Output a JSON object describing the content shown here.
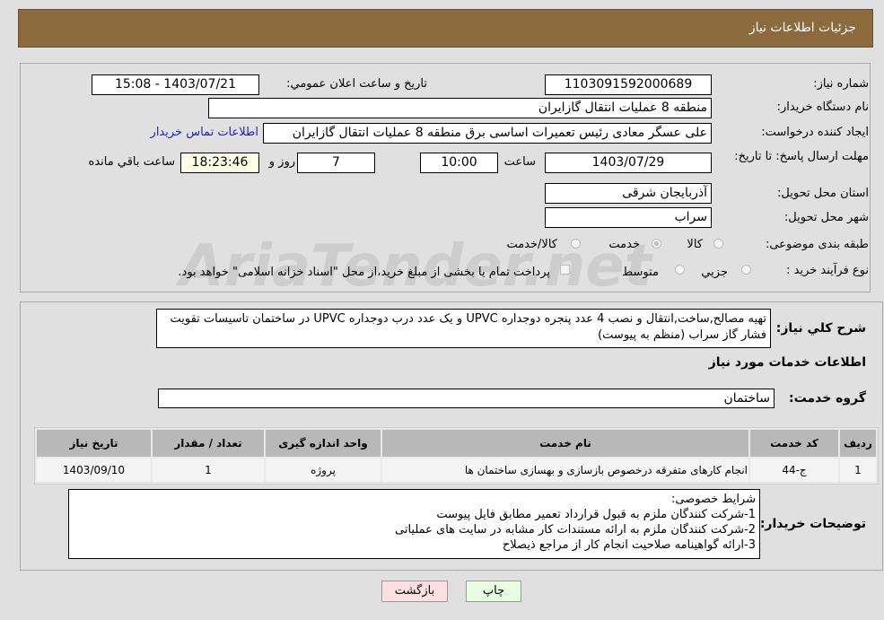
{
  "header": {
    "title": "جزئیات اطلاعات نیاز"
  },
  "form": {
    "need_number_label": "شماره نیاز:",
    "need_number": "1103091592000689",
    "announce_label": "تاریخ و ساعت اعلان عمومي:",
    "announce_value": "1403/07/21 - 15:08",
    "buyer_org_label": "نام دستگاه خریدار:",
    "buyer_org": "منطقه 8 عملیات انتقال گازایران",
    "creator_label": "ایجاد کننده درخواست:",
    "creator": "علی عسگر معادی رئیس تعمیرات اساسی برق منطقه 8 عملیات انتقال گازایران",
    "contact_link": "اطلاعات تماس خریدار",
    "deadline_label": "مهلت ارسال پاسخ: تا تاریخ:",
    "deadline_date": "1403/07/29",
    "time_label": "ساعت",
    "deadline_time": "10:00",
    "days": "7",
    "days_label": "روز و",
    "remaining": "18:23:46",
    "remaining_label": "ساعت باقي مانده",
    "province_label": "استان محل تحویل:",
    "province": "آذربایجان شرقی",
    "city_label": "شهر محل تحویل:",
    "city": "سراب",
    "category_label": "طبقه بندی موضوعی:",
    "category_options": [
      "کالا",
      "خدمت",
      "کالا/خدمت"
    ],
    "category_selected": "خدمت",
    "process_label": "نوع فرآیند خرید :",
    "process_options": [
      "جزيي",
      "متوسط"
    ],
    "payment_note": "پرداخت تمام یا بخشی از مبلغ خرید،از محل \"اسناد خزانه اسلامی\" خواهد بود."
  },
  "description": {
    "label": "شرح كلي نياز:",
    "text": "تهیه مصالح,ساخت,انتقال و نصب 4 عدد پنجره دوجداره UPVC و یک عدد درب دوجداره UPVC در ساختمان تاسیسات تقویت فشار گاز سراب (منظم به پیوست)"
  },
  "services": {
    "title": "اطلاعات خدمات مورد نیاز",
    "group_label": "گروه خدمت:",
    "group": "ساختمان",
    "columns": [
      "ردیف",
      "کد خدمت",
      "نام خدمت",
      "واحد اندازه گیری",
      "تعداد / مقدار",
      "تاریخ نیاز"
    ],
    "rows": [
      [
        "1",
        "ج-44",
        "انجام کارهای متفرقه درخصوص بازسازی و بهسازی ساختمان ها",
        "پروژه",
        "1",
        "1403/09/10"
      ]
    ]
  },
  "buyer_notes": {
    "label": "توضیحات خریدار:",
    "lines": [
      "شرایط خصوصی:",
      "1-شرکت کنندگان ملزم به قبول قرارداد تعمیر مطابق فایل پیوست",
      "2-شرکت کنندگان ملزم به ارائه مستندات کار مشابه در سایت های عملیاتی",
      "3-ارائه گواهینامه صلاحیت انجام کار از مراجع ذیصلاح"
    ]
  },
  "buttons": {
    "print": "چاپ",
    "back": "بازگشت"
  },
  "watermark": "AriaTender.net",
  "colors": {
    "header": "#8b6a3e",
    "link": "#2020d0",
    "print_bg": "#e6ffe0",
    "back_bg": "#ffe0e0"
  }
}
